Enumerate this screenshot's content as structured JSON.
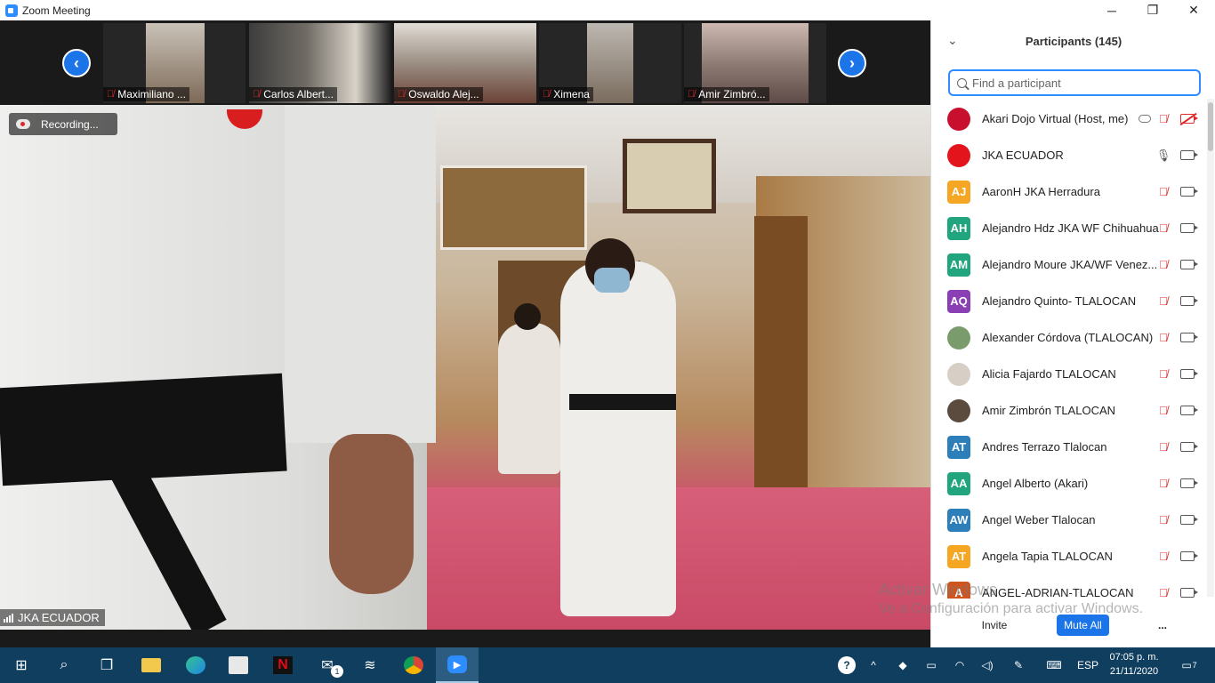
{
  "window": {
    "title": "Zoom Meeting",
    "minimize": "─",
    "restore": "❐",
    "close": "✕"
  },
  "thumbnails": [
    {
      "name": "Maximiliano ...",
      "colors": [
        "#7d6a58",
        "#c9c2b7"
      ]
    },
    {
      "name": "Carlos Albert...",
      "colors": [
        "#3d3d3d",
        "#d8d2c8"
      ]
    },
    {
      "name": "Oswaldo Alej...",
      "colors": [
        "#9b8e83",
        "#6b4236"
      ]
    },
    {
      "name": "Ximena",
      "colors": [
        "#bdb8b1",
        "#7a6c5e"
      ]
    },
    {
      "name": "Amir Zimbró...",
      "colors": [
        "#5e4b48",
        "#cdb9b1"
      ]
    }
  ],
  "nav": {
    "prev": "‹",
    "next": "›"
  },
  "main_video": {
    "recording_label": "Recording...",
    "speaker_label": "JKA ECUADOR"
  },
  "panel": {
    "title": "Participants (145)",
    "search_placeholder": "Find a participant",
    "buttons": {
      "invite": "Invite",
      "mute_all": "Mute All",
      "more": "..."
    },
    "participants": [
      {
        "name": "Akari Dojo Virtual (Host, me)",
        "avatar": "",
        "color": "#c8102e",
        "photo": true,
        "mic": "muted",
        "cam": "off",
        "cloud": true
      },
      {
        "name": "JKA ECUADOR",
        "avatar": "",
        "color": "#e3141c",
        "photo": true,
        "mic": "on",
        "cam": "on",
        "cloud": false
      },
      {
        "name": "AaronH JKA Herradura",
        "avatar": "AJ",
        "color": "#f5a623",
        "photo": false,
        "mic": "muted",
        "cam": "on",
        "cloud": false
      },
      {
        "name": "Alejandro Hdz JKA WF Chihuahua",
        "avatar": "AH",
        "color": "#20a57e",
        "photo": false,
        "mic": "muted",
        "cam": "on",
        "cloud": false
      },
      {
        "name": "Alejandro Moure JKA/WF Venez...",
        "avatar": "AM",
        "color": "#20a57e",
        "photo": false,
        "mic": "muted",
        "cam": "on",
        "cloud": false
      },
      {
        "name": "Alejandro Quinto- TLALOCAN",
        "avatar": "AQ",
        "color": "#8a3fb5",
        "photo": false,
        "mic": "muted",
        "cam": "on",
        "cloud": false
      },
      {
        "name": "Alexander Córdova (TLALOCAN)",
        "avatar": "",
        "color": "#7a9b6c",
        "photo": true,
        "mic": "muted",
        "cam": "on",
        "cloud": false
      },
      {
        "name": "Alicia Fajardo TLALOCAN",
        "avatar": "",
        "color": "#d7cfc6",
        "photo": true,
        "mic": "muted",
        "cam": "on",
        "cloud": false
      },
      {
        "name": "Amir Zimbrón TLALOCAN",
        "avatar": "",
        "color": "#5b4a3e",
        "photo": true,
        "mic": "muted",
        "cam": "on",
        "cloud": false
      },
      {
        "name": "Andres Terrazo Tlalocan",
        "avatar": "AT",
        "color": "#2c7fb8",
        "photo": false,
        "mic": "muted",
        "cam": "on",
        "cloud": false
      },
      {
        "name": "Angel Alberto (Akari)",
        "avatar": "AA",
        "color": "#20a57e",
        "photo": false,
        "mic": "muted",
        "cam": "on",
        "cloud": false
      },
      {
        "name": "Angel Weber Tlalocan",
        "avatar": "AW",
        "color": "#2c7fb8",
        "photo": false,
        "mic": "muted",
        "cam": "on",
        "cloud": false
      },
      {
        "name": "Angela Tapia TLALOCAN",
        "avatar": "AT",
        "color": "#f5a623",
        "photo": false,
        "mic": "muted",
        "cam": "on",
        "cloud": false
      },
      {
        "name": "ANGEL-ADRIAN-TLALOCAN",
        "avatar": "A",
        "color": "#d0541d",
        "photo": false,
        "mic": "muted",
        "cam": "on",
        "cloud": false
      }
    ]
  },
  "watermark": {
    "line1": "Activar Windows",
    "line2": "Ve a Configuración para activar Windows."
  },
  "taskbar": {
    "language": "ESP",
    "time": "07:05 p. m.",
    "date": "21/11/2020",
    "notification_count": "7",
    "mail_badge": "1"
  }
}
